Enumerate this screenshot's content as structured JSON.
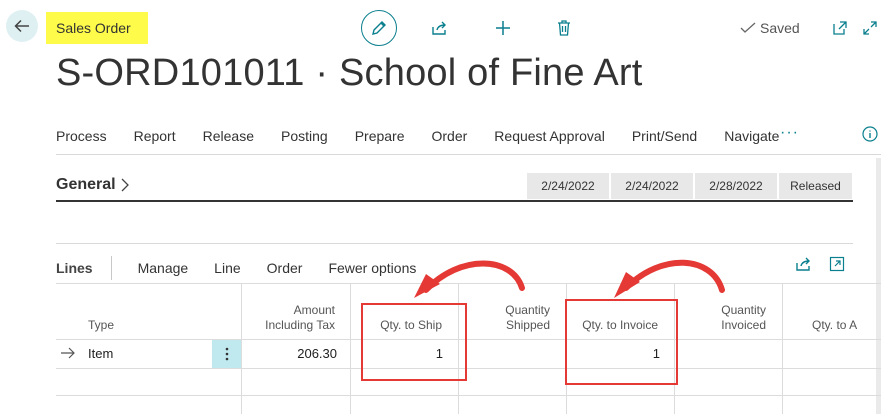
{
  "header": {
    "page_label": "Sales Order",
    "saved_label": "Saved",
    "title": "S-ORD101011 · School of Fine Art"
  },
  "actions": [
    "Process",
    "Report",
    "Release",
    "Posting",
    "Prepare",
    "Order",
    "Request Approval",
    "Print/Send",
    "Navigate"
  ],
  "general": {
    "label": "General",
    "pills": [
      "2/24/2022",
      "2/24/2022",
      "2/28/2022",
      "Released"
    ]
  },
  "lines": {
    "title": "Lines",
    "options": [
      "Manage",
      "Line",
      "Order",
      "Fewer options"
    ],
    "columns": {
      "type": "Type",
      "amount_l1": "Amount",
      "amount_l2": "Including Tax",
      "qty_ship": "Qty. to Ship",
      "qty_shipped_l1": "Quantity",
      "qty_shipped_l2": "Shipped",
      "qty_invoice": "Qty. to Invoice",
      "qty_invoiced_l1": "Quantity",
      "qty_invoiced_l2": "Invoiced",
      "qty_assign": "Qty. to A"
    },
    "row": {
      "type": "Item",
      "amount": "206.30",
      "qty_ship": "1",
      "qty_invoice": "1"
    }
  },
  "colors": {
    "accent": "#0a7f8e",
    "highlight": "#fffb4a",
    "annotation": "#e53935"
  }
}
